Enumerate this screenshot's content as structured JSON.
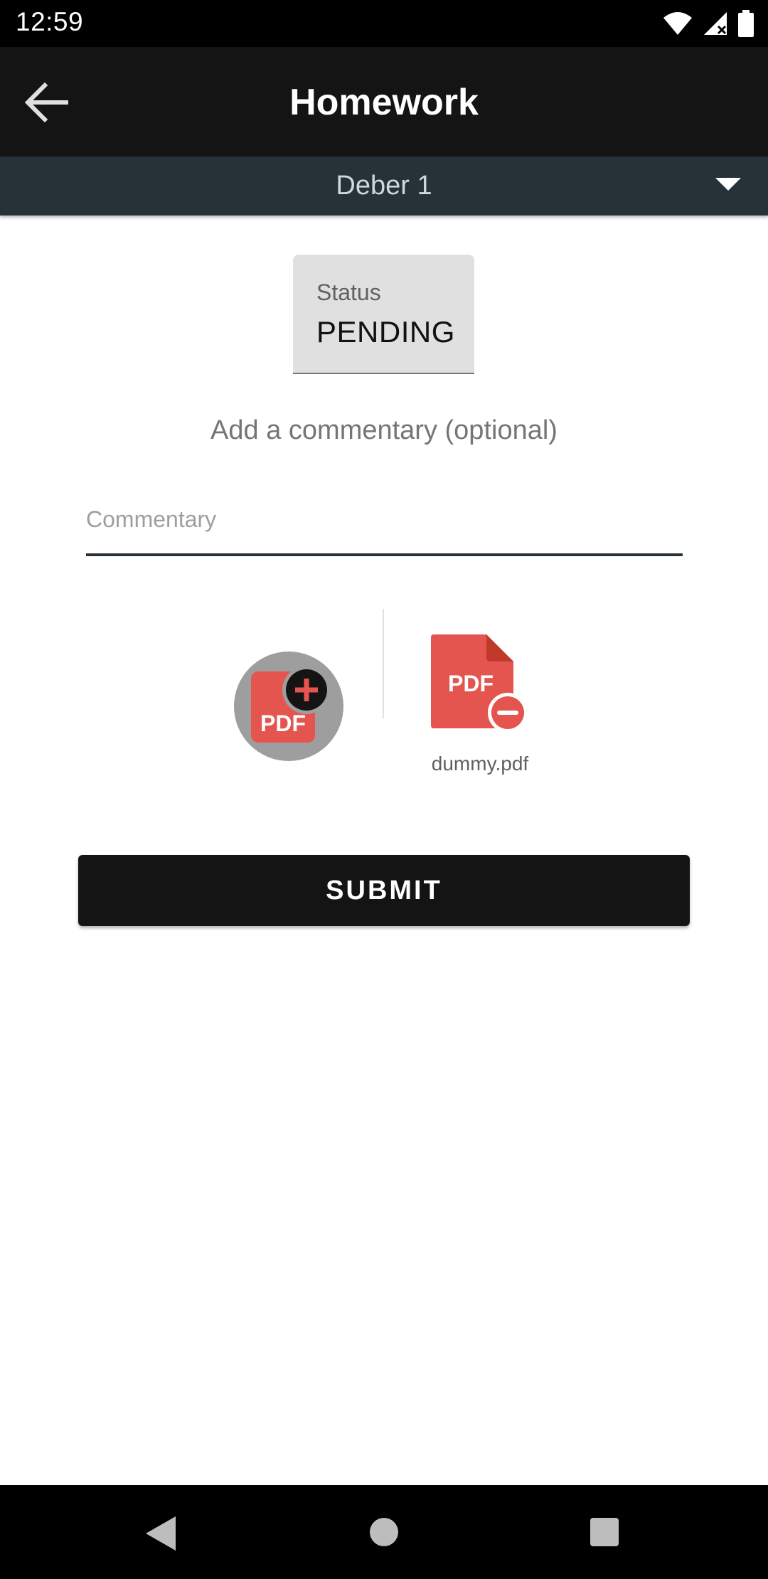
{
  "status_bar": {
    "time": "12:59",
    "icons": [
      "wifi-icon",
      "signal-icon",
      "battery-icon"
    ]
  },
  "app_bar": {
    "title": "Homework",
    "back_icon": "arrow-back-icon"
  },
  "assignment_selector": {
    "selected": "Deber 1",
    "icon": "dropdown-arrow-icon"
  },
  "status": {
    "label": "Status",
    "value": "PENDING"
  },
  "commentary": {
    "prompt": "Add a commentary (optional)",
    "placeholder": "Commentary",
    "value": ""
  },
  "attachments": {
    "add_icon": "add-pdf-icon",
    "file_icon": "remove-pdf-icon",
    "file_name": "dummy.pdf",
    "icon_text": "PDF"
  },
  "submit": {
    "label": "SUBMIT"
  },
  "colors": {
    "app_bar": "#141414",
    "selector_bar": "#263238",
    "pdf_red": "#e5554f",
    "button": "#141414"
  }
}
